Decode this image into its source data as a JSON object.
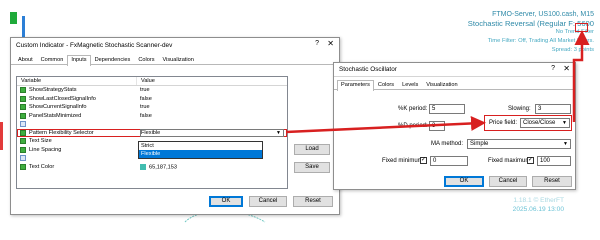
{
  "chart": {
    "server": "FTMO-Server, US100.cash, M15",
    "indicator_title": "Stochastic Reversal (Regular F: 5600",
    "line1": "No Trend Filter",
    "line2": "Time Filter: Off, Trading All Market Hours.",
    "line3": "Spread: 3 points",
    "bottom_line1": "1.18.1 © EtherFT",
    "bottom_line2": "2025.06.19 13:00",
    "colors": {
      "info_text": "#3a9fb5",
      "annotation": "#d82020"
    }
  },
  "custom_indicator": {
    "title": "Custom Indicator - FxMagnetic Stochastic Scanner-dev",
    "help": "?",
    "close": "✕",
    "tabs": [
      "About",
      "Common",
      "Inputs",
      "Dependencies",
      "Colors",
      "Visualization"
    ],
    "active_tab": "Inputs",
    "columns": [
      "Variable",
      "Value"
    ],
    "rows": [
      {
        "icon": "bool-icon",
        "variable": "ShowStrategyStats",
        "value": "true"
      },
      {
        "icon": "bool-icon",
        "variable": "ShowLastClosedSignalInfo",
        "value": "false"
      },
      {
        "icon": "bool-icon",
        "variable": "ShowCurrentSignalInfo",
        "value": "true"
      },
      {
        "icon": "bool-icon",
        "variable": "PanelStatsMinimized",
        "value": "false"
      },
      {
        "icon": "text-icon",
        "variable": "",
        "value": ""
      },
      {
        "icon": "enum-icon",
        "variable": "Pattern Flexibility Selector",
        "value": "Flexible"
      },
      {
        "icon": "int-icon",
        "variable": "Text Size",
        "value": ""
      },
      {
        "icon": "int-icon",
        "variable": "Line Spacing",
        "value": ""
      },
      {
        "icon": "text-icon",
        "variable": "",
        "value": ""
      },
      {
        "icon": "color-icon",
        "variable": "Text Color",
        "value": "65,187,153"
      }
    ],
    "dropdown_options": [
      "Strict",
      "Flexible"
    ],
    "dropdown_selected": "Flexible",
    "side_buttons": {
      "load": "Load",
      "save": "Save"
    },
    "footer": {
      "ok": "OK",
      "cancel": "Cancel",
      "reset": "Reset"
    }
  },
  "stochastic": {
    "title": "Stochastic Oscillator",
    "help": "?",
    "close": "✕",
    "tabs": [
      "Parameters",
      "Colors",
      "Levels",
      "Visualization"
    ],
    "active_tab": "Parameters",
    "k_period_label": "%K period:",
    "k_period_value": "5",
    "d_period_label": "%D period:",
    "d_period_value": "3",
    "slowing_label": "Slowing:",
    "slowing_value": "3",
    "price_field_label": "Price field:",
    "price_field_value": "Close/Close",
    "ma_method_label": "MA method:",
    "ma_method_value": "Simple",
    "fixed_min_label": "Fixed minimum",
    "fixed_min_value": "0",
    "fixed_max_label": "Fixed maximum",
    "fixed_max_value": "100",
    "footer": {
      "ok": "OK",
      "cancel": "Cancel",
      "reset": "Reset"
    }
  }
}
